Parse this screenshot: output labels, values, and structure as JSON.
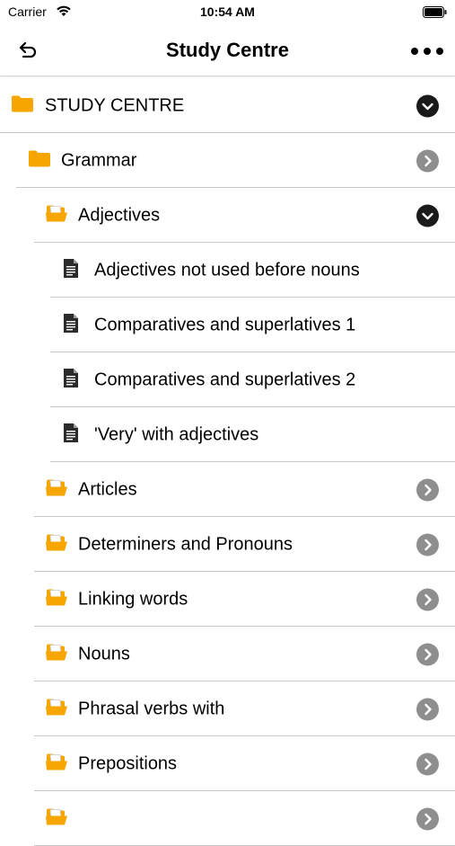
{
  "status": {
    "carrier": "Carrier",
    "time": "10:54 AM"
  },
  "nav": {
    "title": "Study Centre"
  },
  "tree": [
    {
      "label": "STUDY CENTRE",
      "level": 0,
      "kind": "folder",
      "chevron": "down"
    },
    {
      "label": "Grammar",
      "level": 1,
      "kind": "folder",
      "chevron": "right"
    },
    {
      "label": "Adjectives",
      "level": 2,
      "kind": "folder-open",
      "chevron": "down"
    },
    {
      "label": "Adjectives not used before nouns",
      "level": 3,
      "kind": "document",
      "chevron": "none"
    },
    {
      "label": "Comparatives and superlatives 1",
      "level": 3,
      "kind": "document",
      "chevron": "none"
    },
    {
      "label": "Comparatives and superlatives 2",
      "level": 3,
      "kind": "document",
      "chevron": "none"
    },
    {
      "label": "'Very' with adjectives",
      "level": 3,
      "kind": "document",
      "chevron": "none"
    },
    {
      "label": "Articles",
      "level": 2,
      "kind": "folder-open",
      "chevron": "right"
    },
    {
      "label": "Determiners and Pronouns",
      "level": 2,
      "kind": "folder-open",
      "chevron": "right"
    },
    {
      "label": "Linking words",
      "level": 2,
      "kind": "folder-open",
      "chevron": "right"
    },
    {
      "label": "Nouns",
      "level": 2,
      "kind": "folder-open",
      "chevron": "right"
    },
    {
      "label": "Phrasal verbs with",
      "level": 2,
      "kind": "folder-open",
      "chevron": "right"
    },
    {
      "label": "Prepositions",
      "level": 2,
      "kind": "folder-open",
      "chevron": "right"
    },
    {
      "label": "",
      "level": 2,
      "kind": "folder-open",
      "chevron": "right"
    }
  ],
  "colors": {
    "folder": "#f7a600",
    "chevron_dark": "#1a1a1a",
    "chevron_grey": "#8e8e8e"
  }
}
